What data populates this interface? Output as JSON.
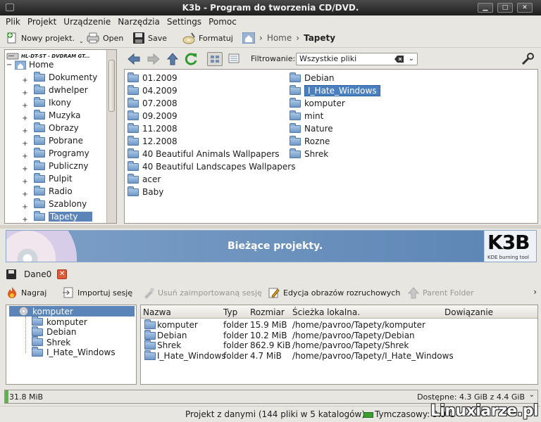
{
  "window": {
    "title": "K3b - Program do tworzenia CD/DVD."
  },
  "menu": [
    "Plik",
    "Projekt",
    "Urządzenie",
    "Narzędzia",
    "Settings",
    "Pomoc"
  ],
  "toolbar": {
    "new_project": "Nowy projekt.",
    "open": "Open",
    "save": "Save",
    "format": "Formatuj"
  },
  "breadcrumb": {
    "home": "Home",
    "current": "Tapety"
  },
  "tree": {
    "device": "HL-DT-ST - DVDRAM GT...",
    "home": "Home",
    "folders": [
      "Dokumenty",
      "dwhelper",
      "Ikony",
      "Muzyka",
      "Obrazy",
      "Pobrane",
      "Programy",
      "Publiczny",
      "Pulpit",
      "Radio",
      "Szablony",
      "Tapety"
    ],
    "selected": "Tapety"
  },
  "filter": {
    "label": "Filtrowanie:",
    "value": "Wszystkie pliki"
  },
  "files": {
    "col1": [
      "01.2009",
      "04.2009",
      "07.2008",
      "09.2009",
      "11.2008",
      "12.2008",
      "40 Beautiful Animals Wallpapers",
      "40 Beautiful Landscapes Wallpapers",
      "acer",
      "Baby"
    ],
    "col2": [
      "Debian",
      "I_Hate_Windows",
      "komputer",
      "mint",
      "Nature",
      "Rozne",
      "Shrek"
    ],
    "selected": "I_Hate_Windows"
  },
  "banner": {
    "title": "Bieżące projekty.",
    "logo": "K3B",
    "logo_sub": "KDE burning tool"
  },
  "project": {
    "tab": "Dane0"
  },
  "project_toolbar": {
    "burn": "Nagraj",
    "import": "Importuj sesję",
    "remove_import": "Usuń zaimportowaną sesję",
    "boot": "Edycja obrazów rozruchowych",
    "parent": "Parent Folder"
  },
  "project_tree": {
    "root": "komputer",
    "children": [
      "komputer",
      "Debian",
      "Shrek",
      "I_Hate_Windows"
    ]
  },
  "table": {
    "headers": [
      "Nazwa",
      "Typ",
      "Rozmiar",
      "Ścieżka lokalna.",
      "Dowiązanie"
    ],
    "rows": [
      {
        "name": "komputer",
        "type": "folder",
        "size": "15.9 MiB",
        "path": "/home/pavroo/Tapety/komputer"
      },
      {
        "name": "Debian",
        "type": "folder",
        "size": "10.2 MiB",
        "path": "/home/pavroo/Tapety/Debian"
      },
      {
        "name": "Shrek",
        "type": "folder",
        "size": "862.9 KiB",
        "path": "/home/pavroo/Tapety/Shrek"
      },
      {
        "name": "I_Hate_Windows",
        "type": "folder",
        "size": "4.7 MiB",
        "path": "/home/pavroo/Tapety/I_Hate_Windows"
      }
    ]
  },
  "capacity": {
    "used": "31.8 MiB",
    "free": "Dostępne: 4.3 GiB z 4.4 GiB",
    "fill_fraction": 0.007
  },
  "status": {
    "project": "Projekt z danymi (144 pliki w 5 katalogów)",
    "temp": "Tymczasowy: 3.9 G"
  },
  "watermark": "Linuxiarze.pl"
}
